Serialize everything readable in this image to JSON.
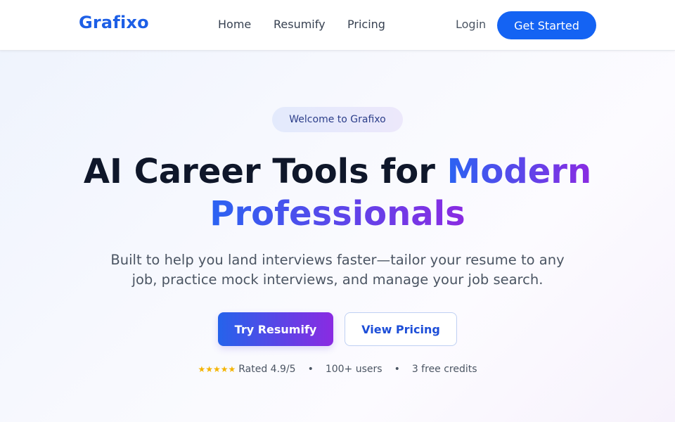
{
  "header": {
    "brand": "Grafixo",
    "nav": {
      "home": "Home",
      "resumify": "Resumify",
      "pricing": "Pricing"
    },
    "login_label": "Login",
    "cta_label": "Get Started"
  },
  "hero": {
    "badge": "Welcome to Grafixo",
    "title_part1": "AI Career Tools for ",
    "title_highlight_1": "Modern",
    "title_highlight_2": "Professionals",
    "subtitle": "Built to help you land interviews faster—tailor your resume to any job, practice mock interviews, and manage your job search.",
    "primary_button": "Try Resumify",
    "secondary_button": "View Pricing"
  },
  "stats": {
    "stars": "★★★★★",
    "rating": "Rated 4.9/5",
    "separator": "•",
    "users": "100+ users",
    "credits": "3 free credits"
  },
  "colors": {
    "brand_blue": "#1d5fe6",
    "cta_blue": "#1463f3",
    "gradient_start": "#2563eb",
    "gradient_end": "#8a2be2",
    "star_gold": "#f4b400"
  }
}
